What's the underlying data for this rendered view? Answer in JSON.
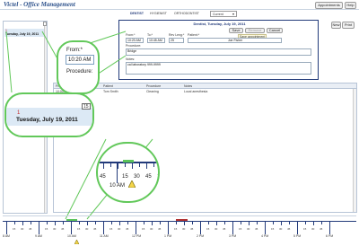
{
  "header": {
    "app_title": "Victel - Office Management",
    "appointments_label": "Appointments",
    "help_label": "Help"
  },
  "provider_tabs": [
    "DENTIST",
    "HYGIENIST",
    "ORTHODONTIST"
  ],
  "view_select": {
    "value": "Current"
  },
  "toolbar": {
    "new_label": "New",
    "print_label": "Print"
  },
  "left_panel": {
    "date_number": "1",
    "date_line": "Tuesday, July 19, 2011"
  },
  "form": {
    "title": "Dentist, Tuesday, July 19, 2011",
    "save_label": "Save",
    "remove_label": "Remove",
    "cancel_label": "Cancel",
    "tooltip": "Save appointment",
    "from_label": "From:*",
    "from_value": "10:20 AM",
    "to_label": "To:*",
    "to_value": "10:45 AM",
    "rev_label": "Rev Leng:*",
    "rev_value": "25",
    "patient_label": "Patient:*",
    "patient_value": "Joe Fisher",
    "procedure_label": "Procedure:",
    "procedure_value": "Bridge",
    "notes_label": "Notes:",
    "notes_value": "cal laboratory 999-9999"
  },
  "zoom_form": {
    "from_label": "From:*",
    "from_value": "10:20 AM",
    "procedure_label": "Procedure:"
  },
  "zoom_left": {
    "tab_value": "15",
    "date_number": "1",
    "date_line": "Tuesday, July 19, 2011"
  },
  "table": {
    "headers": [
      "From",
      "To",
      "Patient",
      "Procedure",
      "Notes"
    ],
    "rows": [
      {
        "from": "10:00 AM",
        "to": "10:45 AM",
        "patient": "Tom Smith",
        "procedure": "Cleaning",
        "notes": "Local anesthesia"
      }
    ]
  },
  "zoom_timeline": {
    "labels": [
      "45",
      "15",
      "30",
      "45",
      "1"
    ],
    "hour_label": "10 AM",
    "edge_label": "1"
  },
  "timeline": {
    "hours": [
      "8 AM",
      "9 AM",
      "10 AM",
      "11 AM",
      "12 PM",
      "1 PM",
      "2 PM",
      "3 PM",
      "4 PM",
      "5 PM",
      "6 PM"
    ],
    "minutes": [
      "15",
      "30",
      "45",
      "15",
      "30",
      "45",
      "15",
      "30",
      "45",
      "15",
      "30",
      "45",
      "15",
      "30",
      "45",
      "15",
      "30",
      "45",
      "15",
      "30",
      "45",
      "15",
      "30",
      "45",
      "15",
      "30",
      "45",
      "15",
      "30",
      "45",
      "15",
      "30",
      "45"
    ]
  },
  "colors": {
    "accent_blue": "#223a7a",
    "green": "#62c85a",
    "red_block": "#b03030",
    "panel_bg": "#dce9f5"
  }
}
